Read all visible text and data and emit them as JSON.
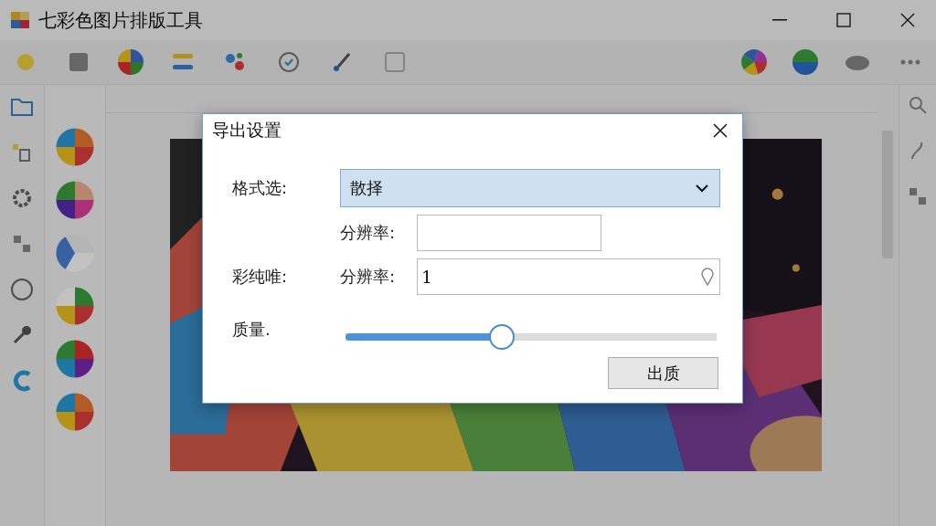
{
  "window": {
    "title": "七彩色图片排版工具"
  },
  "dialog": {
    "title": "导出设置",
    "format": {
      "label": "格式选:",
      "value": "散择"
    },
    "resolution": {
      "label": "分辨率:"
    },
    "color_row": {
      "label": "彩纯唯:",
      "field_label": "分辨率:",
      "value": "1"
    },
    "quality": {
      "label": "质量.",
      "level": 0.42
    },
    "buttons": [
      "出质"
    ]
  }
}
